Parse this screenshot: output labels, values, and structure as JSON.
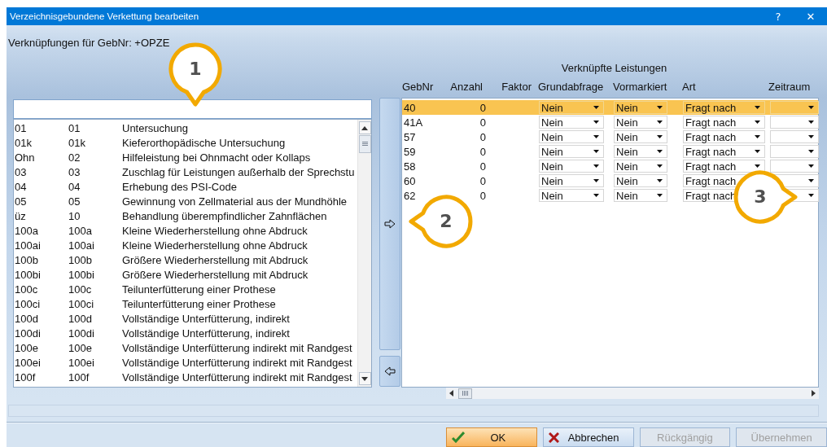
{
  "window": {
    "title": "Verzeichnisgebundene Verkettung bearbeiten",
    "help_button": "?",
    "close_button": "✕"
  },
  "heading": "Verknüpfungen für GebNr: +OPZE",
  "catalog": {
    "rows": [
      {
        "column_1": "01",
        "column_2": "01",
        "column_3": "Untersuchung"
      },
      {
        "column_1": "01k",
        "column_2": "01k",
        "column_3": "Kieferorthopädische Untersuchung"
      },
      {
        "column_1": "Ohn",
        "column_2": "02",
        "column_3": "Hilfeleistung bei Ohnmacht oder Kollaps"
      },
      {
        "column_1": "03",
        "column_2": "03",
        "column_3": "Zuschlag für Leistungen außerhalb der Sprechstu"
      },
      {
        "column_1": "04",
        "column_2": "04",
        "column_3": "Erhebung des PSI-Code"
      },
      {
        "column_1": "05",
        "column_2": "05",
        "column_3": "Gewinnung von Zellmaterial aus der Mundhöhle"
      },
      {
        "column_1": "üz",
        "column_2": "10",
        "column_3": "Behandlung überempfindlicher Zahnflächen"
      },
      {
        "column_1": "100a",
        "column_2": "100a",
        "column_3": "Kleine Wiederherstellung ohne Abdruck"
      },
      {
        "column_1": "100ai",
        "column_2": "100ai",
        "column_3": "Kleine Wiederherstellung ohne Abdruck"
      },
      {
        "column_1": "100b",
        "column_2": "100b",
        "column_3": "Größere Wiederherstellung mit Abdruck"
      },
      {
        "column_1": "100bi",
        "column_2": "100bi",
        "column_3": "Größere Wiederherstellung mit Abdruck"
      },
      {
        "column_1": "100c",
        "column_2": "100c",
        "column_3": "Teilunterfütterung einer Prothese"
      },
      {
        "column_1": "100ci",
        "column_2": "100ci",
        "column_3": "Teilunterfütterung einer Prothese"
      },
      {
        "column_1": "100d",
        "column_2": "100d",
        "column_3": "Vollständige Unterfütterung, indirekt"
      },
      {
        "column_1": "100di",
        "column_2": "100di",
        "column_3": "Vollständige Unterfütterung, indirekt"
      },
      {
        "column_1": "100e",
        "column_2": "100e",
        "column_3": "Vollständige Unterfütterung indirekt mit Randgest"
      },
      {
        "column_1": "100ei",
        "column_2": "100ei",
        "column_3": "Vollständige Unterfütterung indirekt mit Randgest"
      },
      {
        "column_1": "100f",
        "column_2": "100f",
        "column_3": "Vollständige Unterfütterung indirekt mit Randgest"
      }
    ]
  },
  "linked": {
    "title": "Verknüpfte Leistungen",
    "columns": [
      "GebNr",
      "Anzahl",
      "Faktor",
      "Grundabfrage",
      "Vormarkiert",
      "Art",
      "Zeitraum"
    ],
    "rows": [
      {
        "gebnr": "40",
        "anzahl": "0",
        "grundabfrage": "Nein",
        "vormarkiert": "Nein",
        "art": "Fragt nach",
        "selected": true
      },
      {
        "gebnr": "41A",
        "anzahl": "0",
        "grundabfrage": "Nein",
        "vormarkiert": "Nein",
        "art": "Fragt nach",
        "selected": false
      },
      {
        "gebnr": "57",
        "anzahl": "0",
        "grundabfrage": "Nein",
        "vormarkiert": "Nein",
        "art": "Fragt nach",
        "selected": false
      },
      {
        "gebnr": "59",
        "anzahl": "0",
        "grundabfrage": "Nein",
        "vormarkiert": "Nein",
        "art": "Fragt nach",
        "selected": false
      },
      {
        "gebnr": "58",
        "anzahl": "0",
        "grundabfrage": "Nein",
        "vormarkiert": "Nein",
        "art": "Fragt nach",
        "selected": false
      },
      {
        "gebnr": "60",
        "anzahl": "0",
        "grundabfrage": "Nein",
        "vormarkiert": "Nein",
        "art": "Fragt nach",
        "selected": false
      },
      {
        "gebnr": "62",
        "anzahl": "0",
        "grundabfrage": "Nein",
        "vormarkiert": "Nein",
        "art": "Fragt nach",
        "selected": false
      }
    ]
  },
  "buttons": [
    {
      "label": "OK",
      "kind": "ok",
      "disabled": false
    },
    {
      "label": "Abbrechen",
      "kind": "cancel",
      "disabled": false
    },
    {
      "label": "Rückgängig",
      "kind": "plain",
      "disabled": true
    },
    {
      "label": "Übernehmen",
      "kind": "plain",
      "disabled": true
    }
  ],
  "callouts": [
    {
      "label": "1"
    },
    {
      "label": "2"
    },
    {
      "label": "3"
    }
  ]
}
